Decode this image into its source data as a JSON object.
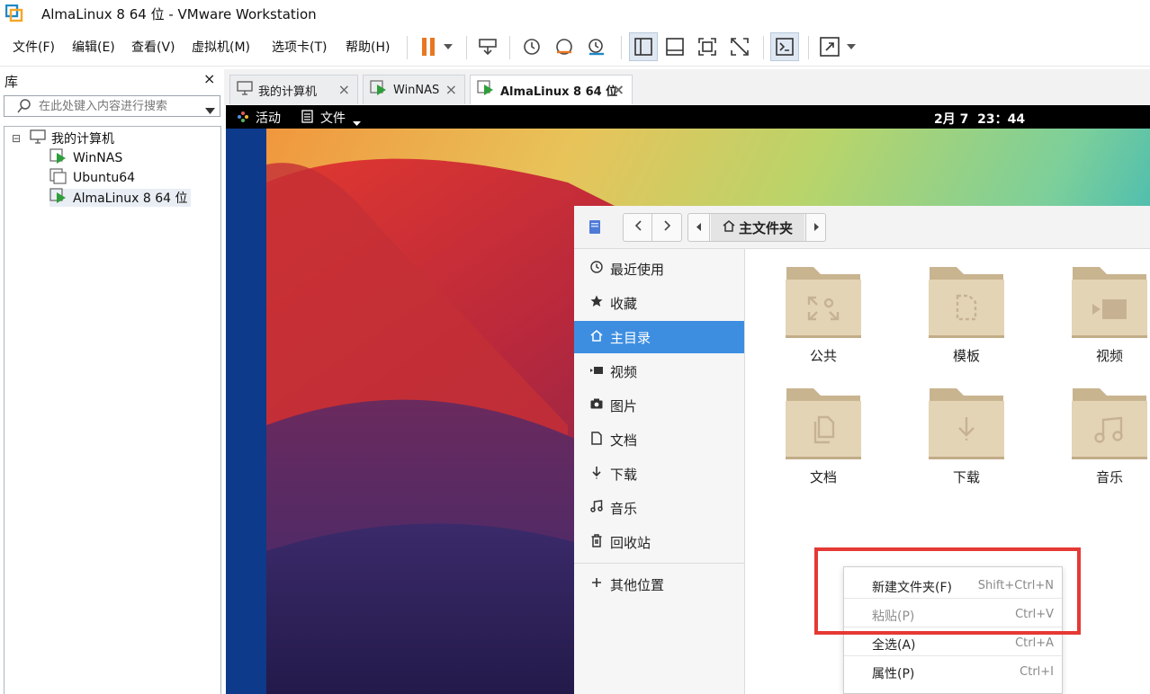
{
  "window": {
    "title": "AlmaLinux 8 64 位 - VMware Workstation"
  },
  "menu": {
    "items": [
      "文件(F)",
      "编辑(E)",
      "查看(V)",
      "虚拟机(M)",
      "选项卡(T)",
      "帮助(H)"
    ]
  },
  "toolbar": {
    "icons": [
      "pause-icon",
      "dropdown-arrow-icon",
      "send-ctrl-alt-del-icon",
      "snapshot-icon",
      "revert-snapshot-icon",
      "snapshot-manager-icon",
      "library-view-icon",
      "thumbnail-view-icon",
      "full-screen-icon",
      "unity-icon",
      "console-icon",
      "stretch-icon"
    ],
    "accent": "#e87722"
  },
  "library": {
    "title": "库",
    "close": "×",
    "search_placeholder": "在此处键入内容进行搜索",
    "tree": [
      {
        "label": "我的计算机",
        "expander": "⊟"
      },
      {
        "label": "WinNAS"
      },
      {
        "label": "Ubuntu64"
      },
      {
        "label": "AlmaLinux 8 64 位",
        "selected": true
      }
    ]
  },
  "tabs": [
    {
      "label": "我的计算机",
      "close": "×"
    },
    {
      "label": "WinNAS",
      "close": "×"
    },
    {
      "label": "AlmaLinux 8 64 位",
      "close": "×",
      "active": true
    }
  ],
  "gnome": {
    "activities": "活动",
    "app_menu": "文件",
    "clock": "2月 7  23：44"
  },
  "nautilus": {
    "location": "主文件夹",
    "sidebar": [
      {
        "label": "最近使用",
        "icon": "clock-icon"
      },
      {
        "label": "收藏",
        "icon": "star-icon"
      },
      {
        "label": "主目录",
        "icon": "home-icon",
        "selected": true
      },
      {
        "label": "视频",
        "icon": "video-icon"
      },
      {
        "label": "图片",
        "icon": "camera-icon"
      },
      {
        "label": "文档",
        "icon": "document-icon"
      },
      {
        "label": "下载",
        "icon": "download-icon"
      },
      {
        "label": "音乐",
        "icon": "music-icon"
      },
      {
        "label": "回收站",
        "icon": "trash-icon"
      },
      {
        "label": "其他位置",
        "icon": "plus-icon"
      }
    ],
    "folders": [
      {
        "label": "公共",
        "icon": "share-icon"
      },
      {
        "label": "模板",
        "icon": "template-icon"
      },
      {
        "label": "视频",
        "icon": "video-icon"
      },
      {
        "label": "文档",
        "icon": "document-icon"
      },
      {
        "label": "下载",
        "icon": "download-icon"
      },
      {
        "label": "音乐",
        "icon": "music-icon"
      }
    ],
    "folder_color": "#d8c6a2"
  },
  "context_menu": {
    "items": [
      {
        "label": "新建文件夹(F)",
        "shortcut": "Shift+Ctrl+N"
      },
      {
        "label": "粘贴(P)",
        "shortcut": "Ctrl+V",
        "disabled": true
      },
      {
        "label": "全选(A)",
        "shortcut": "Ctrl+A"
      },
      {
        "label": "属性(P)",
        "shortcut": "Ctrl+I"
      }
    ],
    "highlight_color": "#e53935"
  }
}
